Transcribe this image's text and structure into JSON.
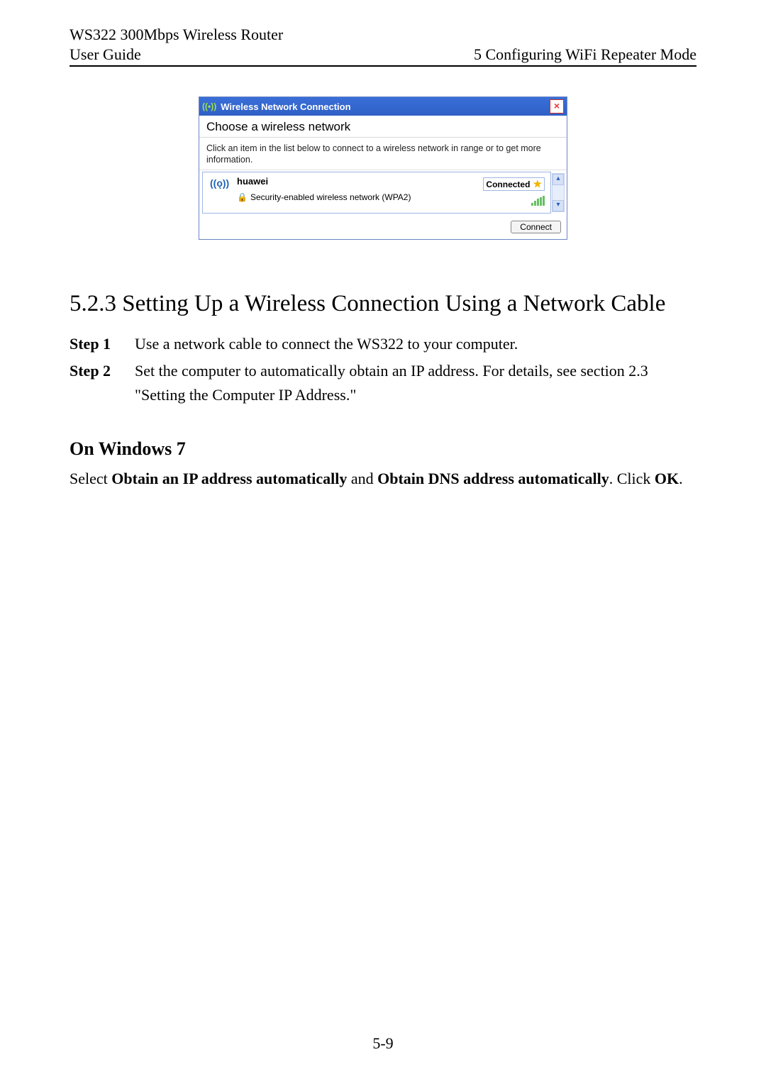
{
  "header": {
    "product": "WS322 300Mbps Wireless Router",
    "doc": "User Guide",
    "chapter": "5 Configuring WiFi Repeater Mode"
  },
  "dialog": {
    "title": "Wireless Network Connection",
    "choose": "Choose a wireless network",
    "hint": "Click an item in the list below to connect to a wireless network in range or to get more information.",
    "item": {
      "name": "huawei",
      "status": "Connected",
      "security": "Security-enabled wireless network (WPA2)"
    },
    "connect": "Connect"
  },
  "section_heading": "5.2.3 Setting Up a Wireless Connection Using a Network Cable",
  "steps": {
    "s1_label": "Step 1",
    "s1_body": "Use a network cable to connect the WS322 to your computer.",
    "s2_label": "Step 2",
    "s2_body": "Set the computer to automatically obtain an IP address. For details, see section 2.3 \"Setting the Computer IP Address.\""
  },
  "sub_heading": "On Windows 7",
  "para_parts": {
    "p0": "Select ",
    "b1": "Obtain an IP address automatically",
    "p1": " and ",
    "b2": "Obtain DNS address automatically",
    "p2": ". Click ",
    "b3": "OK",
    "p3": "."
  },
  "page_number": "5-9"
}
